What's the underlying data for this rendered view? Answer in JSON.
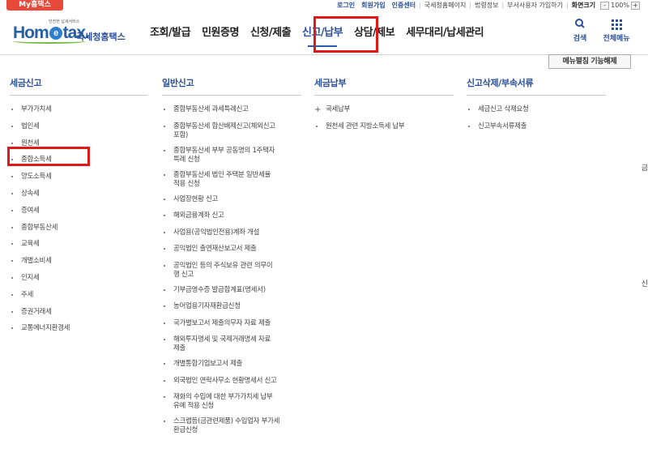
{
  "topbar": {
    "my_hometax": "My홈택스",
    "links": [
      "로그인",
      "회원가입",
      "인증센터",
      "국세청홈페이지",
      "법령정보",
      "부서사용자 가입하기"
    ],
    "screen_size_label": "화면크기",
    "zoom_minus": "-",
    "zoom_value": "100%",
    "zoom_plus": "+"
  },
  "logo": {
    "small_text": "안전한 납세서비스",
    "main_pre": "Hom",
    "main_e": "e",
    "main_post": "tax.",
    "sub": "국세청홈택스"
  },
  "gnb": [
    "조회/발급",
    "민원증명",
    "신청/제출",
    "신고/납부",
    "상담/제보",
    "세무대리/납세관리"
  ],
  "header_buttons": {
    "search": "검색",
    "all_menu": "전체메뉴"
  },
  "unlock_button": "메뉴펼침 기능해제",
  "columns": [
    {
      "title": "세금신고",
      "items": [
        "부가가치세",
        "법인세",
        "원천세",
        "종합소득세",
        "양도소득세",
        "상속세",
        "증여세",
        "종합부동산세",
        "교육세",
        "개별소비세",
        "인지세",
        "주세",
        "증권거래세",
        "교통에너지환경세"
      ]
    },
    {
      "title": "일반신고",
      "items": [
        [
          "종합부동산세 과세특례신고"
        ],
        [
          "종합부동산세 합산배제신고(체외신고",
          "포함)"
        ],
        [
          "종합부동산세 부부 공동명의 1주택자",
          "특례 신청"
        ],
        [
          "종합부동산세 법인 주택분 일반세율",
          "적용 신청"
        ],
        [
          "사업장현황 신고"
        ],
        [
          "해외금융계좌 신고"
        ],
        [
          "사업용(공익법인전용)계좌 개설"
        ],
        [
          "공익법인 출연재산보고서 제출"
        ],
        [
          "공익법인 등의 주식보유 관련 의무이",
          "행 신고"
        ],
        [
          "기부금영수증 발급합계표(명세서)"
        ],
        [
          "농어업용기자재환급신청"
        ],
        [
          "국가별보고서 제출의무자 자료 제출"
        ],
        [
          "해외투자명세 및 국제거래명세 자료",
          "제출"
        ],
        [
          "개별통합기업보고서 제출"
        ],
        [
          "외국법인 연락사무소 현황명세서 신고"
        ],
        [
          "재화의 수입에 대한 부가가치세 납부",
          "유예 적용 신청"
        ],
        [
          "스크랩등(금관련제품) 수입업자 부가세",
          "환급신청"
        ]
      ]
    },
    {
      "title": "세금납부",
      "items": [
        "국세납부",
        "원천세 관련 지방소득세 납부"
      ]
    },
    {
      "title": "신고삭제/부속서류",
      "items": [
        "세금신고 삭제요청",
        "신고부속서류제출"
      ]
    }
  ],
  "edge_fragments": [
    "금",
    "신"
  ],
  "colors": {
    "accent": "#2a4f9a",
    "highlight": "#e01818",
    "my_hometax_bg": "#e8493a"
  }
}
